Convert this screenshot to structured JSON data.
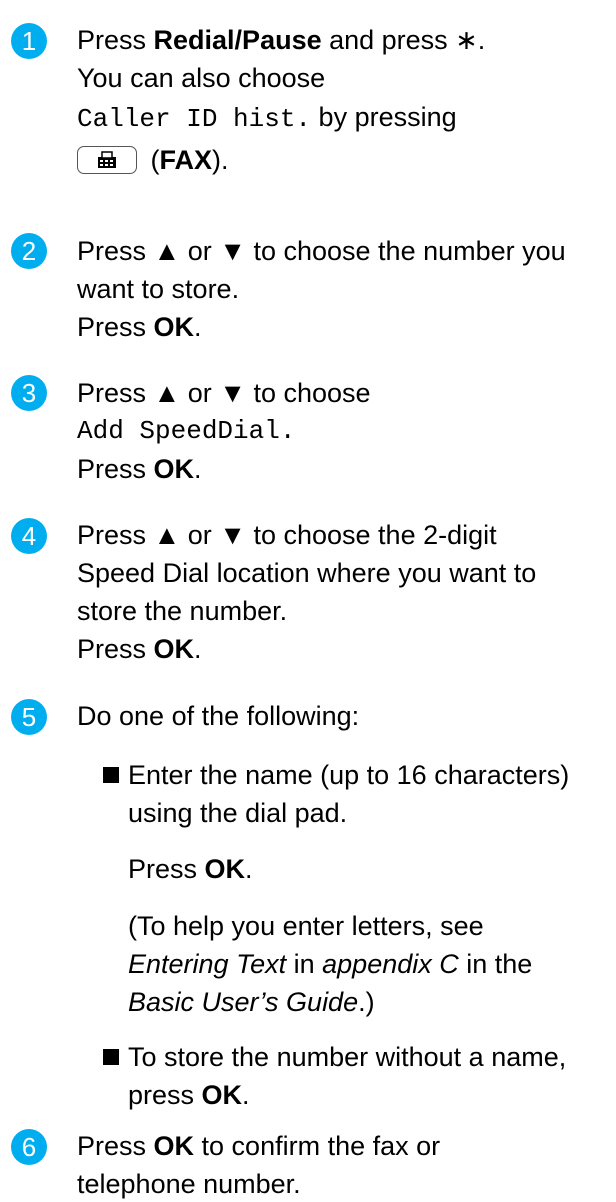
{
  "accent_color": "#00aeef",
  "steps": [
    {
      "number": "1",
      "line1_a": "Press ",
      "line1_b": "Redial/Pause",
      "line1_c": " and press ∗.",
      "line2": "You can also choose",
      "line3_mono": "Caller ID hist.",
      "line3_b": " by pressing",
      "line4_open": " (",
      "line4_bold": "FAX",
      "line4_close": ").",
      "fax_icon": "fax-button-icon"
    },
    {
      "number": "2",
      "line1": "Press ▲ or ▼ to choose the number you",
      "line2": "want to store.",
      "line3_a": "Press ",
      "line3_b": "OK",
      "line3_c": "."
    },
    {
      "number": "3",
      "line1": "Press ▲ or ▼ to choose",
      "line2_mono": "Add SpeedDial.",
      "line3_a": "Press ",
      "line3_b": "OK",
      "line3_c": "."
    },
    {
      "number": "4",
      "line1": "Press ▲ or ▼ to choose the 2-digit",
      "line2": "Speed Dial location where you want to",
      "line3": "store the number.",
      "line4_a": "Press ",
      "line4_b": "OK",
      "line4_c": "."
    },
    {
      "number": "5",
      "line1": "Do one of the following:",
      "bullet1": {
        "line1": "Enter the name (up to 16 characters)",
        "line2": "using the dial pad.",
        "press_a": "Press ",
        "press_b": "OK",
        "press_c": ".",
        "note1": "(To help you enter letters, see",
        "note2_i1": "Entering Text",
        "note2_m": " in ",
        "note2_i2": "appendix C",
        "note2_e": " in the",
        "note3_i": "Basic User’s Guide",
        "note3_e": ".)"
      },
      "bullet2": {
        "line1": "To store the number without a name,",
        "line2_a": "press ",
        "line2_b": "OK",
        "line2_c": "."
      }
    },
    {
      "number": "6",
      "line1_a": "Press ",
      "line1_b": "OK",
      "line1_c": " to confirm the fax or",
      "line2": "telephone number."
    }
  ]
}
